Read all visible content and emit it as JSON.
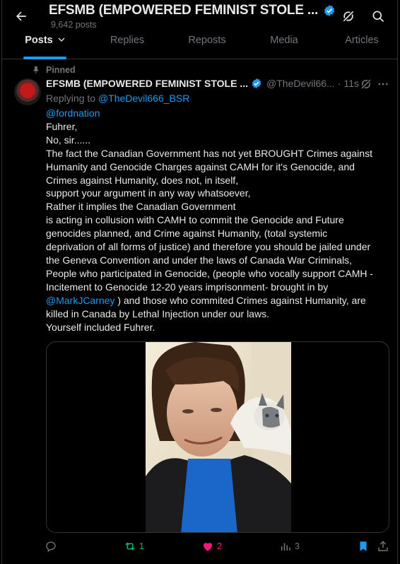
{
  "header": {
    "title": "EFSMB (EMPOWERED FEMINIST STOLE ...",
    "post_count": "9,642 posts"
  },
  "tabs": [
    {
      "label": "Posts",
      "active": true
    },
    {
      "label": "Replies",
      "active": false
    },
    {
      "label": "Reposts",
      "active": false
    },
    {
      "label": "Media",
      "active": false
    },
    {
      "label": "Articles",
      "active": false
    }
  ],
  "post": {
    "pinned_label": "Pinned",
    "author_name": "EFSMB (EMPOWERED FEMINIST STOLE ...",
    "handle": "@TheDevil66...",
    "separator": "·",
    "time": "11s",
    "replying_prefix": "Replying to ",
    "replying_handle": "@TheDevil666_BSR",
    "mention_top": "@fordnation",
    "lines": [
      "Fuhrer,",
      "No, sir......",
      "The fact the Canadian Government has not yet BROUGHT Crimes against",
      "Humanity and Genocide Charges against CAMH for it's Genocide, and",
      "Crimes against Humanity, does not, in itself,",
      "support your argument in any way whatsoever,",
      "Rather it implies the Canadian Government",
      "is acting in collusion with CAMH to commit the Genocide and Future",
      "genocides planned, and Crime against Humanity, (total systemic",
      "deprivation of all forms of justice) and therefore you should be jailed under",
      "the Geneva Convention and under the laws of Canada War Criminals,",
      "People who participated in Genocide, (people who vocally support CAMH -",
      "Incitement to Genocide 12-20 years imprisonment- brought in by"
    ],
    "mention_inline": "@MarkJCarney",
    "after_mention": " ) and those who commited Crimes against Humanity, are",
    "lines_end": [
      "killed in Canada by Lethal Injection under our laws.",
      "Yourself included Fuhrer."
    ],
    "actions": {
      "reply_count": "",
      "repost_count": "1",
      "like_count": "2",
      "views_count": "3"
    }
  },
  "colors": {
    "accent": "#1d9bf0",
    "repost_green": "#00ba7c",
    "like_pink": "#f91880",
    "muted": "#71767b"
  }
}
